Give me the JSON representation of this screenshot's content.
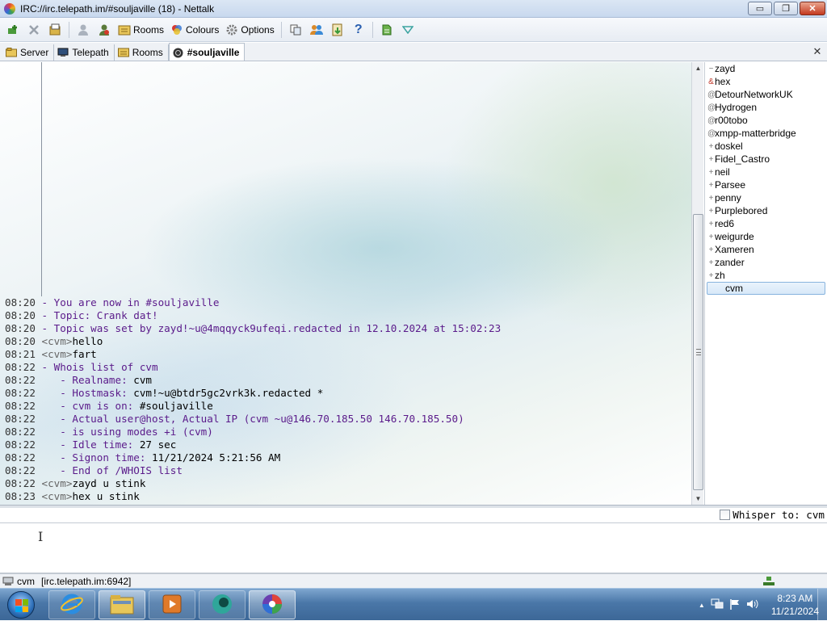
{
  "window": {
    "title": "IRC://irc.telepath.im/#souljaville (18)  -  Nettalk",
    "controls": {
      "minimize": "▭",
      "maximize": "❐",
      "close": "✕"
    }
  },
  "toolbar": {
    "rooms_label": "Rooms",
    "colours_label": "Colours",
    "options_label": "Options",
    "icons": [
      "connect-icon",
      "disconnect-icon",
      "server-list-icon",
      "user-icon",
      "user-remove-icon",
      "rooms-icon",
      "colours-icon",
      "options-icon",
      "copy-icon",
      "users-icon",
      "save-icon",
      "help-icon",
      "script-icon",
      "dropdown-icon"
    ],
    "help_glyph": "?"
  },
  "tabs": [
    {
      "label": "Server",
      "icon": "server-icon"
    },
    {
      "label": "Telepath",
      "icon": "network-icon"
    },
    {
      "label": "Rooms",
      "icon": "rooms-icon"
    },
    {
      "label": "#souljaville",
      "icon": "channel-icon",
      "active": true
    }
  ],
  "tab_close": "✕",
  "chat": {
    "lines": [
      {
        "time": "08:20",
        "type": "sys",
        "text": "- You are now in #souljaville"
      },
      {
        "time": "08:20",
        "type": "sys",
        "text": "- Topic: Crank dat!"
      },
      {
        "time": "08:20",
        "type": "sys",
        "text": "- Topic was set by zayd!~u@4mqqyck9ufeqi.redacted in 12.10.2024 at 15:02:23"
      },
      {
        "time": "08:20",
        "type": "msg",
        "nick": "<cvm>",
        "text": "hello"
      },
      {
        "time": "08:21",
        "type": "msg",
        "nick": "<cvm>",
        "text": "fart"
      },
      {
        "time": "08:22",
        "type": "sys",
        "text": "- Whois list of cvm"
      },
      {
        "time": "08:22",
        "type": "whois",
        "label": "   - Realname: ",
        "value": "cvm"
      },
      {
        "time": "08:22",
        "type": "whois",
        "label": "   - Hostmask: ",
        "value": "cvm!~u@btdr5gc2vrk3k.redacted *"
      },
      {
        "time": "08:22",
        "type": "whois",
        "label": "   - cvm is on: ",
        "value": "#souljaville"
      },
      {
        "time": "08:22",
        "type": "whois",
        "label": "   - Actual user@host, Actual IP (cvm ~u@146.70.185.50 146.70.185.50)",
        "value": ""
      },
      {
        "time": "08:22",
        "type": "whois",
        "label": "   - is using modes +i (cvm)",
        "value": ""
      },
      {
        "time": "08:22",
        "type": "whois",
        "label": "   - Idle time: ",
        "value": "27 sec"
      },
      {
        "time": "08:22",
        "type": "whois",
        "label": "   - Signon time: ",
        "value": "11/21/2024 5:21:56 AM"
      },
      {
        "time": "08:22",
        "type": "whois",
        "label": "   - End of /WHOIS list",
        "value": ""
      },
      {
        "time": "08:22",
        "type": "msg",
        "nick": "<cvm>",
        "text": "zayd u stink"
      },
      {
        "time": "08:23",
        "type": "msg",
        "nick": "<cvm>",
        "text": "hex u stink"
      }
    ]
  },
  "users": [
    {
      "prefix": "~",
      "name": "zayd"
    },
    {
      "prefix": "&",
      "name": "hex"
    },
    {
      "prefix": "@",
      "name": "DetourNetworkUK"
    },
    {
      "prefix": "@",
      "name": "Hydrogen"
    },
    {
      "prefix": "@",
      "name": "r00tobo"
    },
    {
      "prefix": "@",
      "name": "xmpp-matterbridge"
    },
    {
      "prefix": "+",
      "name": "doskel"
    },
    {
      "prefix": "+",
      "name": "Fidel_Castro"
    },
    {
      "prefix": "+",
      "name": "neil"
    },
    {
      "prefix": "+",
      "name": "Parsee"
    },
    {
      "prefix": "+",
      "name": "penny"
    },
    {
      "prefix": "+",
      "name": "Purplebored"
    },
    {
      "prefix": "+",
      "name": "red6"
    },
    {
      "prefix": "+",
      "name": "weigurde"
    },
    {
      "prefix": "+",
      "name": "Xameren"
    },
    {
      "prefix": "+",
      "name": "zander"
    },
    {
      "prefix": "+",
      "name": "zh"
    },
    {
      "prefix": "",
      "name": "cvm",
      "selected": true
    }
  ],
  "input": {
    "whisper_label": "Whisper to: cvm",
    "value": ""
  },
  "status": {
    "nick": "cvm",
    "server": "[irc.telepath.im:6942]"
  },
  "taskbar": {
    "apps": [
      "windows-start-icon",
      "internet-explorer-icon",
      "file-explorer-icon",
      "media-player-icon",
      "app-icon",
      "nettalk-icon"
    ],
    "time": "8:23 AM",
    "date": "11/21/2024",
    "tray_icons": [
      "show-hidden-icons-icon",
      "network-icon",
      "action-center-flag-icon",
      "volume-icon"
    ]
  },
  "colors": {
    "system_text": "#5a1a8a",
    "nick_text": "#666666",
    "taskbar": "#4a77a8"
  }
}
